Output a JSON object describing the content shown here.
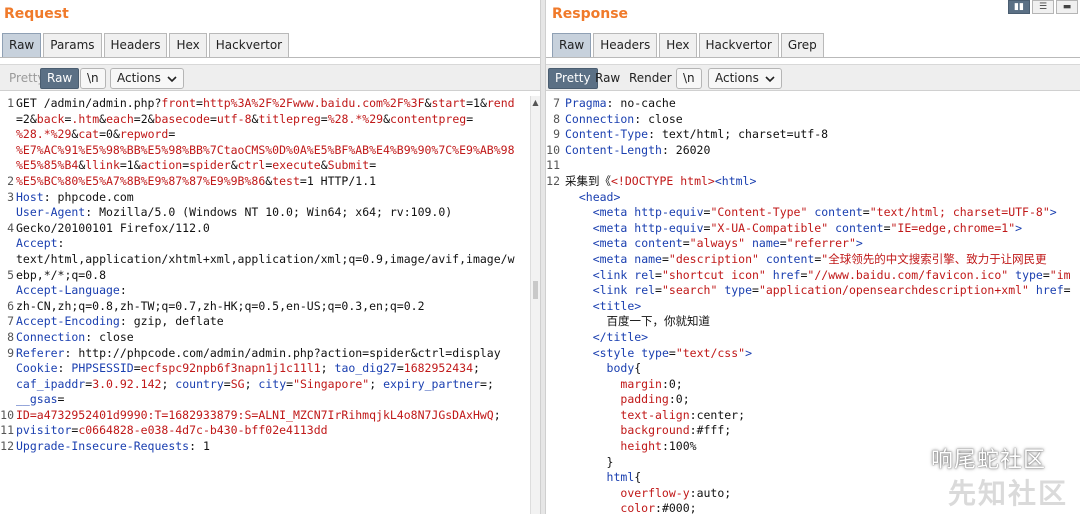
{
  "request": {
    "title": "Request",
    "tabs": [
      "Raw",
      "Params",
      "Headers",
      "Hex",
      "Hackvertor"
    ],
    "toolbar": {
      "pretty": "Pretty",
      "raw": "Raw",
      "newline": "\\n",
      "actions": "Actions"
    }
  },
  "response": {
    "title": "Response",
    "tabs": [
      "Raw",
      "Headers",
      "Hex",
      "Hackvertor",
      "Grep"
    ],
    "toolbar": {
      "pretty": "Pretty",
      "raw": "Raw",
      "render": "Render",
      "newline": "\\n",
      "actions": "Actions"
    }
  },
  "watermark": {
    "text": "响尾蛇社区",
    "faint": "先知社区"
  }
}
